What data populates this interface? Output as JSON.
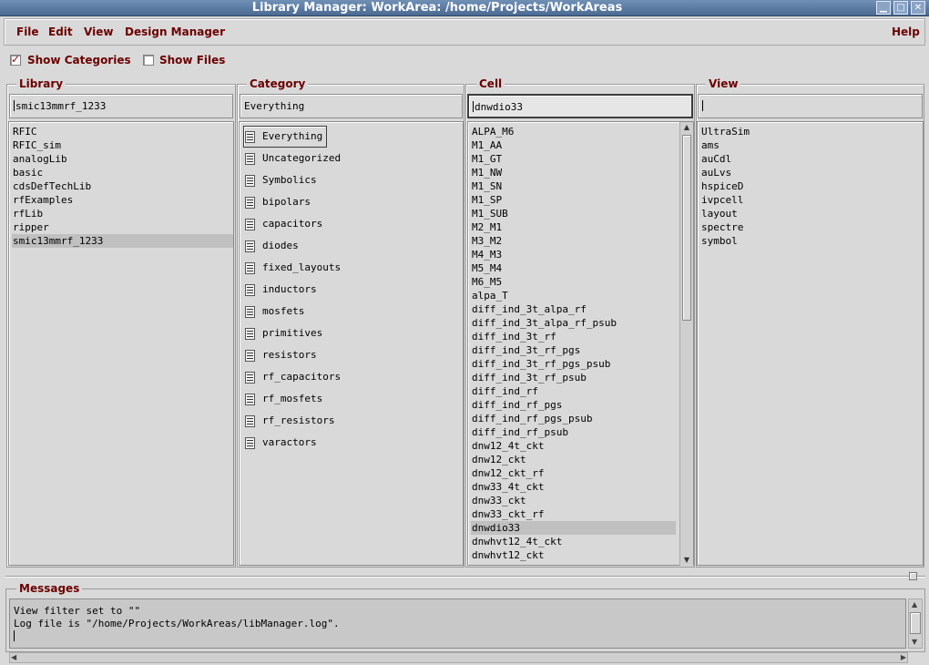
{
  "window": {
    "title": "Library Manager: WorkArea: /home/Projects/WorkAreas",
    "controls": [
      "minimize",
      "maximize",
      "close"
    ]
  },
  "menubar": {
    "items": [
      "File",
      "Edit",
      "View",
      "Design Manager"
    ],
    "help": "Help"
  },
  "options": {
    "show_categories": {
      "label": "Show Categories",
      "checked": true
    },
    "show_files": {
      "label": "Show Files",
      "checked": false
    }
  },
  "library": {
    "title": "Library",
    "filter": "smic13mmrf_1233",
    "items": [
      "RFIC",
      "RFIC_sim",
      "analogLib",
      "basic",
      "cdsDefTechLib",
      "rfExamples",
      "rfLib",
      "ripper",
      "smic13mmrf_1233"
    ],
    "selected": "smic13mmrf_1233"
  },
  "category": {
    "title": "Category",
    "filter": "Everything",
    "items": [
      "Everything",
      "Uncategorized",
      "Symbolics",
      "bipolars",
      "capacitors",
      "diodes",
      "fixed_layouts",
      "inductors",
      "mosfets",
      "primitives",
      "resistors",
      "rf_capacitors",
      "rf_mosfets",
      "rf_resistors",
      "varactors"
    ],
    "selected": "Everything"
  },
  "cell": {
    "title": "Cell",
    "filter": "dnwdio33",
    "items": [
      "ALPA_M6",
      "M1_AA",
      "M1_GT",
      "M1_NW",
      "M1_SN",
      "M1_SP",
      "M1_SUB",
      "M2_M1",
      "M3_M2",
      "M4_M3",
      "M5_M4",
      "M6_M5",
      "alpa_T",
      "diff_ind_3t_alpa_rf",
      "diff_ind_3t_alpa_rf_psub",
      "diff_ind_3t_rf",
      "diff_ind_3t_rf_pgs",
      "diff_ind_3t_rf_pgs_psub",
      "diff_ind_3t_rf_psub",
      "diff_ind_rf",
      "diff_ind_rf_pgs",
      "diff_ind_rf_pgs_psub",
      "diff_ind_rf_psub",
      "dnw12_4t_ckt",
      "dnw12_ckt",
      "dnw12_ckt_rf",
      "dnw33_4t_ckt",
      "dnw33_ckt",
      "dnw33_ckt_rf",
      "dnwdio33",
      "dnwhvt12_4t_ckt",
      "dnwhvt12_ckt"
    ],
    "selected": "dnwdio33"
  },
  "view": {
    "title": "View",
    "filter": "",
    "items": [
      "UltraSim",
      "ams",
      "auCdl",
      "auLvs",
      "hspiceD",
      "ivpcell",
      "layout",
      "spectre",
      "symbol"
    ]
  },
  "messages": {
    "title": "Messages",
    "lines": [
      "View filter set to \"\"",
      "Log file is \"/home/Projects/WorkAreas/libManager.log\"."
    ]
  },
  "icons": {
    "category_item": "document-icon",
    "checkbox_checked": "checkmark-icon"
  }
}
